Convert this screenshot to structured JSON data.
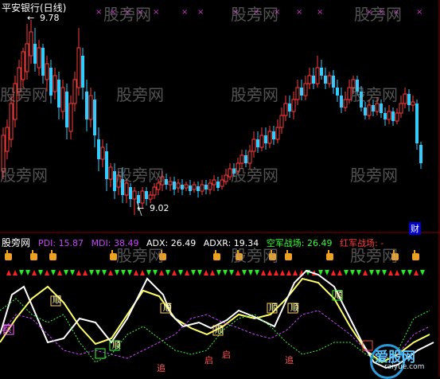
{
  "top_panel": {
    "title": "平安银行(日线)",
    "high_annotation": "9.78",
    "low_annotation": "9.02",
    "finance_badge": "财",
    "colors": {
      "up": "#ff3b3b",
      "down": "#33ccff",
      "background": "#000000"
    }
  },
  "bottom_panel": {
    "title": "股旁网",
    "indicators": [
      {
        "label": "PDI:",
        "value": "15.87",
        "color": "#cc44ff"
      },
      {
        "label": "MDI:",
        "value": "38.49",
        "color": "#cc44ff"
      },
      {
        "label": "ADX:",
        "value": "26.49",
        "color": "#ffffff"
      },
      {
        "label": "ADXR:",
        "value": "19.34",
        "color": "#ffffff"
      },
      {
        "label": "空军战场:",
        "value": "26.49",
        "color": "#33ff33"
      },
      {
        "label": "红军战场:",
        "value": "-",
        "color": "#ff3b3b"
      }
    ],
    "signal_labels": [
      "买",
      "顺",
      "顺",
      "顺",
      "顺",
      "追",
      "追",
      "启",
      "启",
      "顺",
      "顺",
      "顺"
    ]
  },
  "watermarks": [
    "股旁网",
    "股旁网",
    "股旁网",
    "股旁网",
    "股旁网",
    "股旁网",
    "股旁网",
    "股旁网",
    "股旁网",
    "股旁网",
    "股旁网",
    "股旁网",
    "股旁网",
    "股旁网"
  ],
  "corner_logo": {
    "text": "爱股网",
    "url": "raiyue.com"
  }
}
